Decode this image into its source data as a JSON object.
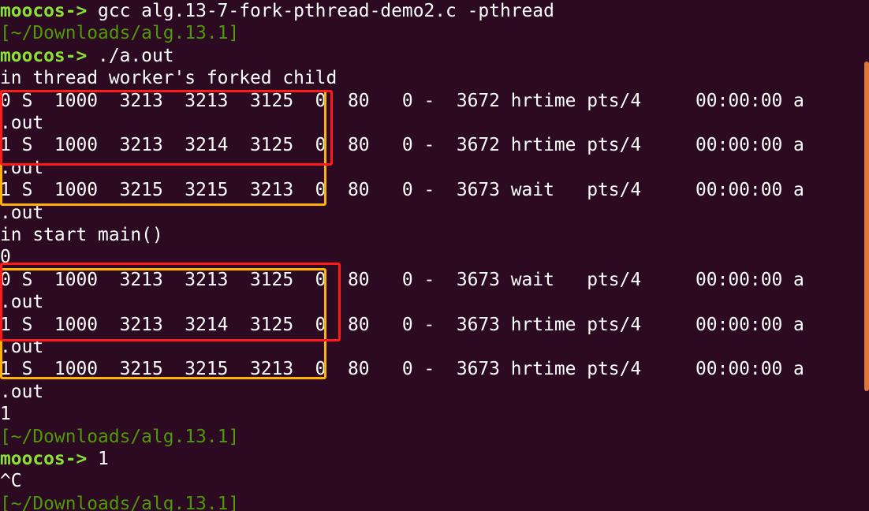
{
  "terminal": {
    "lines": [
      {
        "prompt": "moocos->",
        "text": " gcc alg.13-7-fork-pthread-demo2.c -pthread"
      },
      {
        "path": "[~/Downloads/alg.13.1]"
      },
      {
        "prompt": "moocos->",
        "text": " ./a.out"
      },
      {
        "text": "in thread worker's forked child"
      },
      {
        "text": "0 S  1000  3213  3213  3125  0  80   0 -  3672 hrtime pts/4     00:00:00 a"
      },
      {
        "text": ".out"
      },
      {
        "text": "1 S  1000  3213  3214  3125  0  80   0 -  3672 hrtime pts/4     00:00:00 a"
      },
      {
        "text": ".out"
      },
      {
        "text": "1 S  1000  3215  3215  3213  0  80   0 -  3673 wait   pts/4     00:00:00 a"
      },
      {
        "text": ".out"
      },
      {
        "text": "in start main()"
      },
      {
        "text": "0"
      },
      {
        "text": "0 S  1000  3213  3213  3125  0  80   0 -  3673 wait   pts/4     00:00:00 a"
      },
      {
        "text": ".out"
      },
      {
        "text": "1 S  1000  3213  3214  3125  0  80   0 -  3673 hrtime pts/4     00:00:00 a"
      },
      {
        "text": ".out"
      },
      {
        "text": "1 S  1000  3215  3215  3213  0  80   0 -  3673 hrtime pts/4     00:00:00 a"
      },
      {
        "text": ".out"
      },
      {
        "text": "1"
      },
      {
        "path": "[~/Downloads/alg.13.1]"
      },
      {
        "prompt": "moocos->",
        "text": " 1"
      },
      {
        "text": "^C"
      },
      {
        "path": "[~/Downloads/alg.13.1]"
      }
    ]
  },
  "colors": {
    "background": "#2c0a22",
    "prompt": "#8ae234",
    "path": "#4e9a06",
    "text": "#ffffff",
    "highlight_orange": "#ffb300",
    "highlight_red": "#ff1a1a"
  }
}
